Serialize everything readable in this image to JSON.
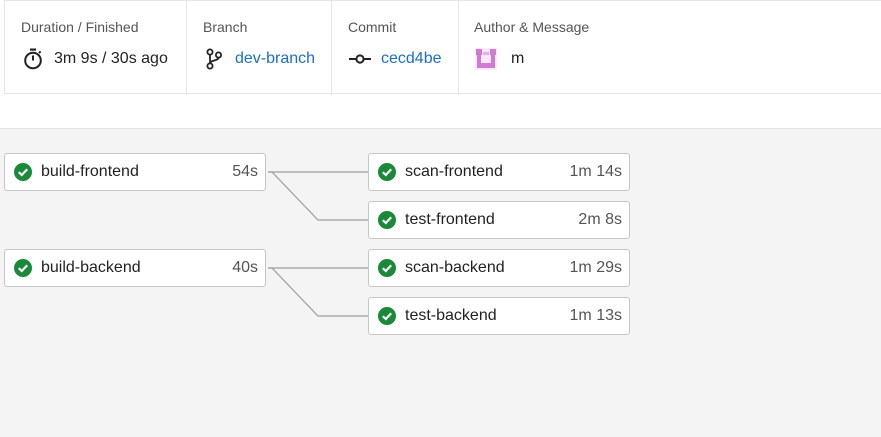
{
  "summary": {
    "duration": {
      "label": "Duration / Finished",
      "value": "3m 9s / 30s ago",
      "icon": "stopwatch-icon"
    },
    "branch": {
      "label": "Branch",
      "value": "dev-branch",
      "icon": "git-branch-icon"
    },
    "commit": {
      "label": "Commit",
      "value": "cecd4be",
      "icon": "git-commit-icon"
    },
    "author": {
      "label": "Author & Message",
      "message": "m",
      "icon": "avatar-icon"
    }
  },
  "colors": {
    "success": "#1a8a3a",
    "link": "#1b6fc4",
    "avatar": "#d07ad4"
  },
  "pipeline": {
    "stage1": [
      {
        "name": "build-frontend",
        "duration": "54s",
        "status": "success"
      },
      {
        "name": "build-backend",
        "duration": "40s",
        "status": "success"
      }
    ],
    "stage2": [
      {
        "name": "scan-frontend",
        "duration": "1m 14s",
        "status": "success"
      },
      {
        "name": "test-frontend",
        "duration": "2m 8s",
        "status": "success"
      },
      {
        "name": "scan-backend",
        "duration": "1m 29s",
        "status": "success"
      },
      {
        "name": "test-backend",
        "duration": "1m 13s",
        "status": "success"
      }
    ]
  }
}
